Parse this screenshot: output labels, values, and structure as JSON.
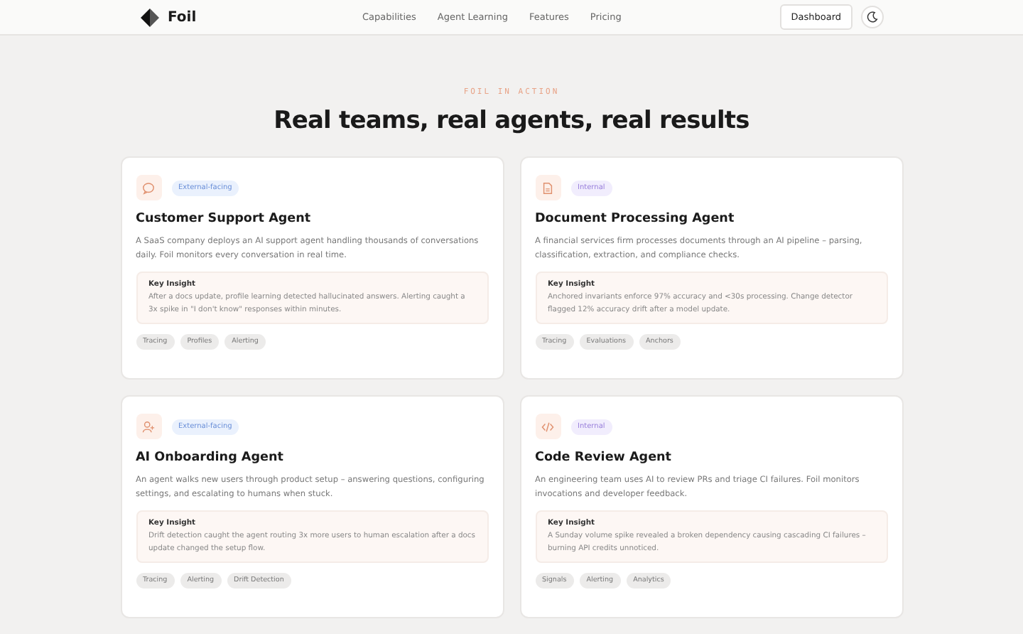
{
  "nav": {
    "brand": "Foil",
    "links": [
      "Capabilities",
      "Agent Learning",
      "Features",
      "Pricing"
    ],
    "cta": "Dashboard"
  },
  "section": {
    "eyebrow": "FOIL IN ACTION",
    "title": "Real teams, real agents, real results"
  },
  "cards": [
    {
      "kind": "chat",
      "badge": {
        "label": "External-facing",
        "kind": "external"
      },
      "title": "Customer Support Agent",
      "description": "A SaaS company deploys an AI support agent handling thousands of conversations daily. Foil monitors every conversation in real time.",
      "insight_label": "Key Insight",
      "insight": "After a docs update, profile learning detected hallucinated answers. Alerting caught a 3x spike in \"I don't know\" responses within minutes.",
      "tags": [
        "Tracing",
        "Profiles",
        "Alerting"
      ]
    },
    {
      "kind": "document",
      "badge": {
        "label": "Internal",
        "kind": "internal"
      },
      "title": "Document Processing Agent",
      "description": "A financial services firm processes documents through an AI pipeline – parsing, classification, extraction, and compliance checks.",
      "insight_label": "Key Insight",
      "insight": "Anchored invariants enforce 97% accuracy and <30s processing. Change detector flagged 12% accuracy drift after a model update.",
      "tags": [
        "Tracing",
        "Evaluations",
        "Anchors"
      ]
    },
    {
      "kind": "user",
      "badge": {
        "label": "External-facing",
        "kind": "external"
      },
      "title": "AI Onboarding Agent",
      "description": "An agent walks new users through product setup – answering questions, configuring settings, and escalating to humans when stuck.",
      "insight_label": "Key Insight",
      "insight": "Drift detection caught the agent routing 3x more users to human escalation after a docs update changed the setup flow.",
      "tags": [
        "Tracing",
        "Alerting",
        "Drift Detection"
      ]
    },
    {
      "kind": "code",
      "badge": {
        "label": "Internal",
        "kind": "internal"
      },
      "title": "Code Review Agent",
      "description": "An engineering team uses AI to review PRs and triage CI failures. Foil monitors invocations and developer feedback.",
      "insight_label": "Key Insight",
      "insight": "A Sunday volume spike revealed a broken dependency causing cascading CI failures – burning API credits unnoticed.",
      "tags": [
        "Signals",
        "Alerting",
        "Analytics"
      ]
    }
  ]
}
